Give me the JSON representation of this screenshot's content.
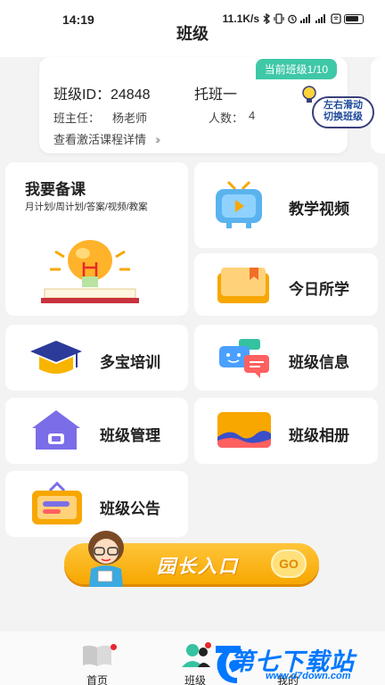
{
  "status_bar": {
    "time": "14:19",
    "net_speed": "11.1K/s"
  },
  "nav": {
    "title": "班级"
  },
  "class_card": {
    "current_tag": "当前班级1/10",
    "class_id_text": "班级ID：24848",
    "class_name": "托班一",
    "teacher_label": "班主任：",
    "teacher_name": "杨老师",
    "count_label": "人数：",
    "count_value": "4",
    "course_link": "查看激活课程详情",
    "swipe_hint": "左右滑动\n切换班级"
  },
  "prep": {
    "title": "我要备课",
    "subtitle": "月计划/周计划/答案/视频/教案"
  },
  "tiles": {
    "teaching_video": "教学视频",
    "today_learned": "今日所学",
    "duobao_training": "多宝培训",
    "class_info": "班级信息",
    "class_management": "班级管理",
    "class_album": "班级相册",
    "class_notice": "班级公告"
  },
  "principal_button": {
    "label": "园长入口",
    "go": "GO"
  },
  "bottom_tabs": [
    {
      "label": "首页"
    },
    {
      "label": "班级"
    },
    {
      "label": "我的"
    }
  ],
  "watermark": {
    "text": "第七下载站",
    "url": "www.d7down.com"
  },
  "colors": {
    "accent_green": "#3fc8a7",
    "gold": "#f7a700",
    "badge_red": "#e8282b",
    "watermark_blue": "#0077ff"
  }
}
